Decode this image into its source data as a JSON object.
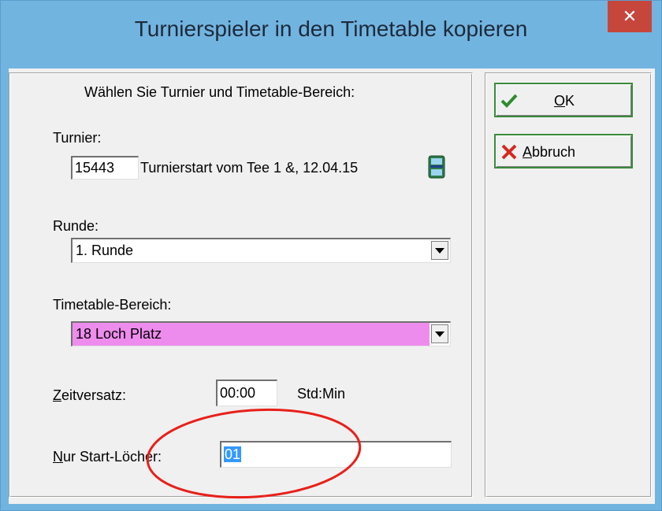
{
  "window": {
    "title": "Turnierspieler in den Timetable kopieren",
    "close_glyph": "✕"
  },
  "form": {
    "heading": "Wählen Sie Turnier und Timetable-Bereich:",
    "turnier_label": "Turnier:",
    "turnier_id": "15443",
    "turnier_desc": "Turnierstart vom Tee 1 &, 12.04.15",
    "runde_label": "Runde:",
    "runde_value": "1. Runde",
    "timetable_label": "Timetable-Bereich:",
    "timetable_value": "18 Loch Platz",
    "timetable_color": "#ee8cee",
    "zeitversatz_label_u": "Z",
    "zeitversatz_label_rest": "eitversatz:",
    "zeitversatz_value": "00:00",
    "zeitversatz_unit": "Std:Min",
    "startloecher_label_u": "N",
    "startloecher_label_rest": "ur Start-Löcher:",
    "startloecher_value": "01"
  },
  "buttons": {
    "ok_u": "O",
    "ok_rest": "K",
    "cancel_u": "A",
    "cancel_rest": "bbruch"
  },
  "annotation": {
    "color": "#e8201a"
  }
}
